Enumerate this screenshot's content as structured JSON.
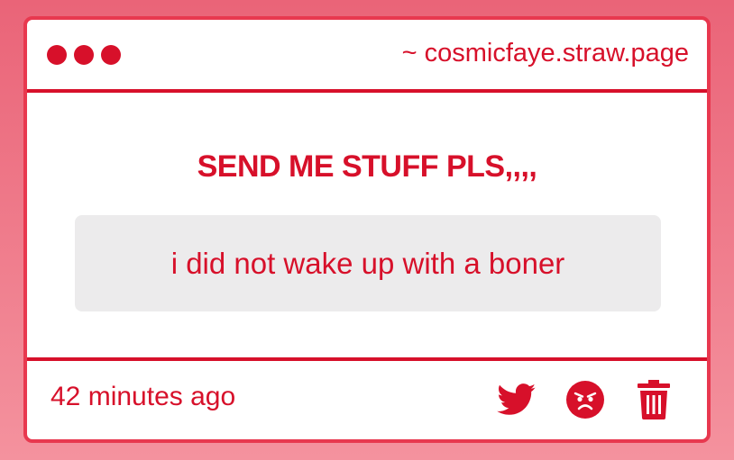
{
  "titlebar": {
    "url": "~ cosmicfaye.straw.page"
  },
  "prompt": {
    "heading": "SEND ME STUFF PLS,,,,"
  },
  "message": {
    "text": "i did not wake up with a boner"
  },
  "footer": {
    "timestamp": "42 minutes ago",
    "actions": [
      {
        "icon": "twitter-icon"
      },
      {
        "icon": "angry-face-icon"
      },
      {
        "icon": "trash-icon"
      }
    ]
  },
  "colors": {
    "accent": "#d7102a",
    "card_border": "#e8384f",
    "message_bg": "#ecebec",
    "background_top": "#ea6478",
    "background_bottom": "#f4929e"
  }
}
